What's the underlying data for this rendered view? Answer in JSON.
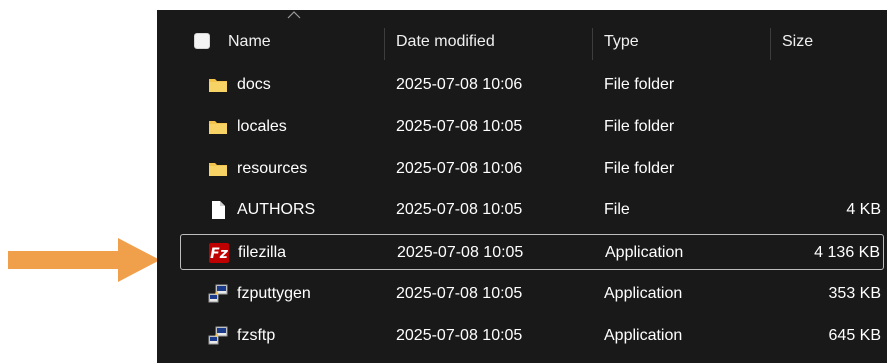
{
  "colors": {
    "background": "#191919",
    "text": "#ffffff",
    "folder": "#f2c44b",
    "arrow": "#f0a04b",
    "selection_border": "#bdbdbd"
  },
  "header": {
    "name": "Name",
    "date_modified": "Date modified",
    "type": "Type",
    "size": "Size"
  },
  "rows": [
    {
      "icon": "folder-icon",
      "name": "docs",
      "date": "2025-07-08 10:06",
      "type": "File folder",
      "size": ""
    },
    {
      "icon": "folder-icon",
      "name": "locales",
      "date": "2025-07-08 10:05",
      "type": "File folder",
      "size": ""
    },
    {
      "icon": "folder-icon",
      "name": "resources",
      "date": "2025-07-08 10:06",
      "type": "File folder",
      "size": ""
    },
    {
      "icon": "file-icon",
      "name": "AUTHORS",
      "date": "2025-07-08 10:05",
      "type": "File",
      "size": "4 KB"
    },
    {
      "icon": "filezilla-icon",
      "name": "filezilla",
      "date": "2025-07-08 10:05",
      "type": "Application",
      "size": "4 136 KB",
      "selected": true
    },
    {
      "icon": "putty-app-icon",
      "name": "fzputtygen",
      "date": "2025-07-08 10:05",
      "type": "Application",
      "size": "353 KB"
    },
    {
      "icon": "putty-app-icon",
      "name": "fzsftp",
      "date": "2025-07-08 10:05",
      "type": "Application",
      "size": "645 KB"
    }
  ]
}
